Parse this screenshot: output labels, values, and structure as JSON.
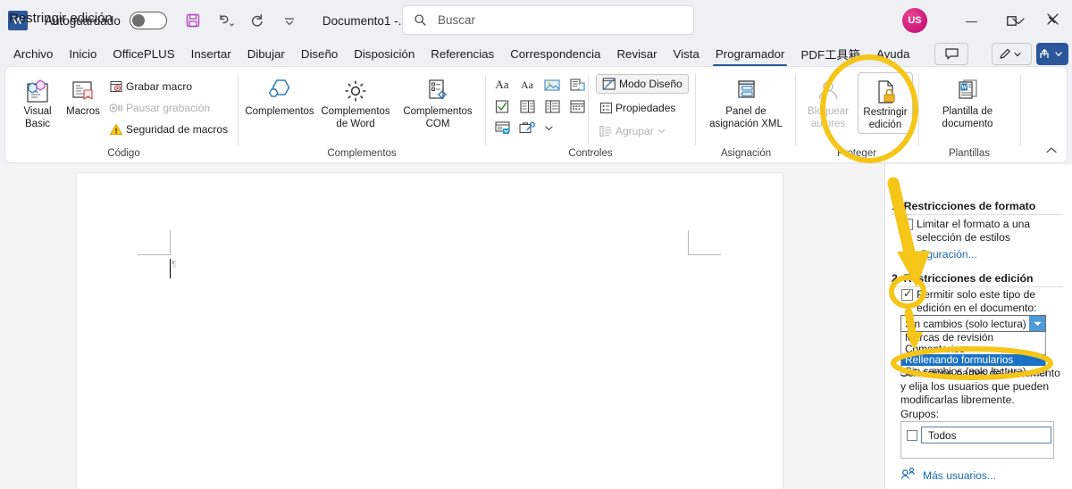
{
  "titlebar": {
    "app_logo": "W",
    "autosave_label": "Autoguardado",
    "autosave_state": "off",
    "save_icon": "save-icon",
    "undo_icon": "undo-icon",
    "redo_icon": "redo-icon",
    "customize_icon": "customize-quick-access-icon",
    "doc_title": "Documento1  -...",
    "avatar_initials": "US",
    "minimize": "—",
    "maximize": "❐",
    "close": "✕"
  },
  "search": {
    "placeholder": "Buscar",
    "icon": "search-icon"
  },
  "tabs": [
    {
      "label": "Archivo",
      "active": false
    },
    {
      "label": "Inicio",
      "active": false
    },
    {
      "label": "OfficePLUS",
      "active": false
    },
    {
      "label": "Insertar",
      "active": false
    },
    {
      "label": "Dibujar",
      "active": false
    },
    {
      "label": "Diseño",
      "active": false
    },
    {
      "label": "Disposición",
      "active": false
    },
    {
      "label": "Referencias",
      "active": false
    },
    {
      "label": "Correspondencia",
      "active": false
    },
    {
      "label": "Revisar",
      "active": false
    },
    {
      "label": "Vista",
      "active": false
    },
    {
      "label": "Programador",
      "active": true
    },
    {
      "label": "PDF工具箱",
      "active": false
    },
    {
      "label": "Ayuda",
      "active": false
    }
  ],
  "tabstrip_right": {
    "comments_label": "comments-icon",
    "editing_label": "pen-editing-icon",
    "share_label": "share-icon"
  },
  "ribbon": {
    "groups": [
      {
        "name": "Código",
        "buttons": [
          {
            "label": "Visual Basic",
            "icon": "visual-basic-icon",
            "enabled": true
          },
          {
            "label": "Macros",
            "icon": "macros-icon",
            "enabled": true
          }
        ],
        "small_items": [
          {
            "label": "Grabar macro",
            "icon": "record-macro-icon",
            "enabled": true
          },
          {
            "label": "Pausar grabación",
            "icon": "pause-recording-icon",
            "enabled": false
          },
          {
            "label": "Seguridad de macros",
            "icon": "warning-triangle-icon",
            "enabled": true
          }
        ]
      },
      {
        "name": "Complementos",
        "buttons": [
          {
            "label": "Complementos",
            "icon": "addins-hexagon-icon",
            "enabled": true
          },
          {
            "label": "Complementos de Word",
            "icon": "gear-icon",
            "enabled": true
          },
          {
            "label": "Complementos COM",
            "icon": "com-addins-icon",
            "enabled": true
          }
        ]
      },
      {
        "name": "Controles",
        "gallery_row1": [
          "rich-text-control-icon",
          "plain-text-control-icon",
          "picture-control-icon",
          "building-block-control-icon"
        ],
        "gallery_row2": [
          "checkbox-control-icon",
          "combo-box-control-icon",
          "dropdown-list-control-icon",
          "date-picker-control-icon"
        ],
        "gallery_row3": [
          "repeating-section-control-icon",
          "legacy-tools-icon",
          "more-chevron-icon"
        ],
        "small_items": [
          {
            "label": "Modo Diseño",
            "icon": "design-mode-icon",
            "enabled": true,
            "toggled": true
          },
          {
            "label": "Propiedades",
            "icon": "properties-icon",
            "enabled": true
          },
          {
            "label": "Agrupar",
            "icon": "group-icon",
            "enabled": false
          }
        ]
      },
      {
        "name": "Asignación",
        "buttons": [
          {
            "label": "Panel de asignación XML",
            "icon": "xml-mapping-pane-icon",
            "enabled": true
          }
        ]
      },
      {
        "name": "Proteger",
        "buttons": [
          {
            "label": "Bloquear autores",
            "icon": "block-authors-icon",
            "enabled": false
          },
          {
            "label": "Restringir edición",
            "icon": "restrict-editing-lock-icon",
            "enabled": true,
            "highlighted": true
          }
        ]
      },
      {
        "name": "Plantillas",
        "buttons": [
          {
            "label": "Plantilla de documento",
            "icon": "document-template-icon",
            "enabled": true
          }
        ]
      }
    ],
    "collapse_icon": "collapse-ribbon-chevron-icon"
  },
  "pane": {
    "title": "Restringir edición",
    "chevron_icon": "chevron-down-icon",
    "close_icon": "close-icon",
    "section1": {
      "heading": "1. Restricciones de formato",
      "checkbox_label": "Limitar el formato a una selección de estilos",
      "checkbox_checked": false,
      "settings_link": "Configuración..."
    },
    "section2": {
      "heading": "2. Restricciones de edición",
      "checkbox_label": "Permitir solo este tipo de edición en el documento:",
      "checkbox_checked": true,
      "combo_value": "Sin cambios (solo lectura)",
      "combo_arrow_icon": "dropdown-arrow-icon",
      "dropdown_open": true,
      "dropdown_options": [
        {
          "label": "Marcas de revisión",
          "selected": false
        },
        {
          "label": "Comentarios",
          "selected": false
        },
        {
          "label": "Rellenando formularios",
          "selected": true
        },
        {
          "label": "Sin cambios (solo lectura)",
          "selected": false
        }
      ],
      "description": "Seleccione partes del documento y elija los usuarios que pueden modificarlas libremente.",
      "groups_label": "Grupos:",
      "group_items": [
        {
          "label": "Todos",
          "checked": false
        }
      ],
      "more_users_link": "Más usuarios...",
      "more_users_icon": "more-users-icon"
    }
  },
  "document": {
    "cursor_pilcrow": "¶"
  },
  "annotations": {
    "circle_restrict_editing": "yellow-highlight-circle",
    "arrow_down": "yellow-arrow-down",
    "circle_checkbox": "yellow-highlight-circle",
    "circle_dropdown_option": "yellow-highlight-ellipse",
    "color": "#F5C518"
  }
}
